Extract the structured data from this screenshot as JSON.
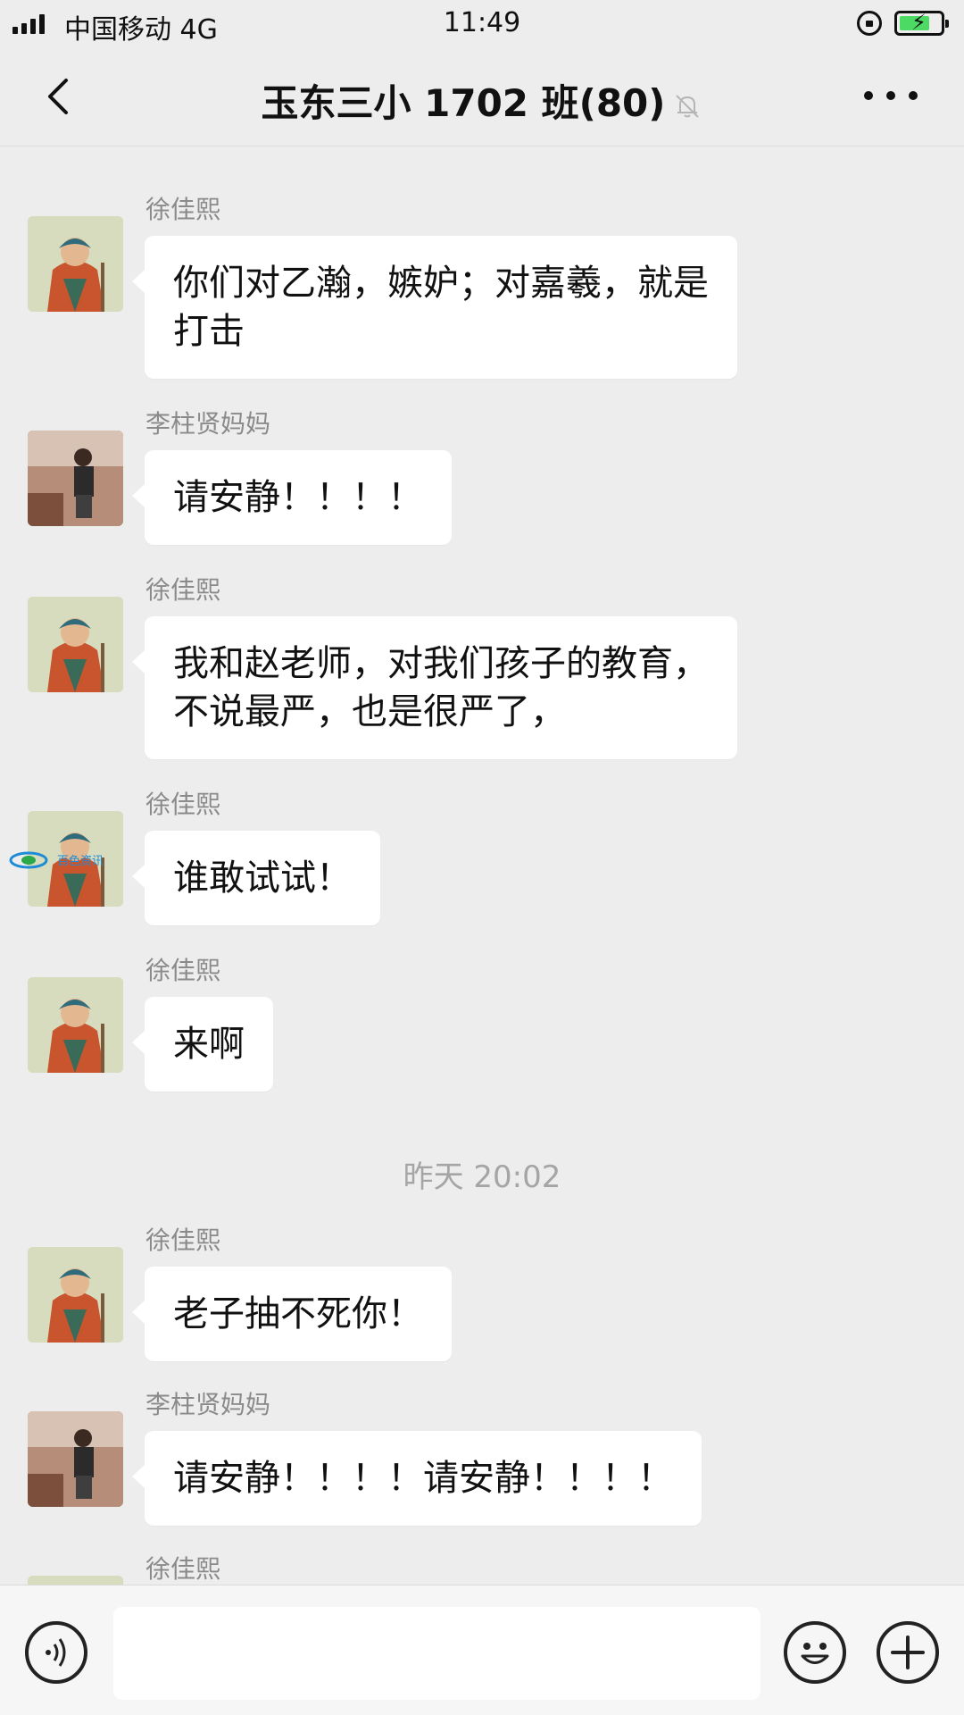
{
  "status_bar": {
    "carrier": "中国移动 4G",
    "time": "11:49",
    "battery_level": 0.75
  },
  "nav": {
    "title": "玉东三小 1702 班(80)",
    "icons": [
      "chevron-left-icon",
      "bell-muted-icon",
      "more-icon"
    ]
  },
  "messages": [
    {
      "sender": "徐佳熙",
      "lines": [
        "你们对乙瀚，嫉妒；对嘉羲，就是",
        "打击"
      ]
    },
    {
      "sender": "李柱贤妈妈",
      "lines": [
        "请安静！！！！"
      ]
    },
    {
      "sender": "徐佳熙",
      "lines": [
        "我和赵老师，对我们孩子的教育，",
        "不说最严，也是很严了，"
      ]
    },
    {
      "sender": "徐佳熙",
      "lines": [
        "谁敢试试！"
      ]
    },
    {
      "sender": "徐佳熙",
      "lines": [
        "来啊"
      ]
    },
    {
      "sender": "徐佳熙",
      "lines": [
        "老子抽不死你！"
      ]
    },
    {
      "sender": "李柱贤妈妈",
      "lines": [
        "请安静！！！！请安静！！！！"
      ]
    },
    {
      "sender": "徐佳熙",
      "lines": []
    }
  ],
  "time_divider": "昨天 20:02",
  "watermark_text": "百色资讯",
  "input_bar": {
    "placeholder": "",
    "icons": [
      "voice-icon",
      "emoji-icon",
      "plus-icon"
    ]
  },
  "colors": {
    "background": "#ededed",
    "bubble": "#ffffff",
    "battery": "#4cd964"
  }
}
